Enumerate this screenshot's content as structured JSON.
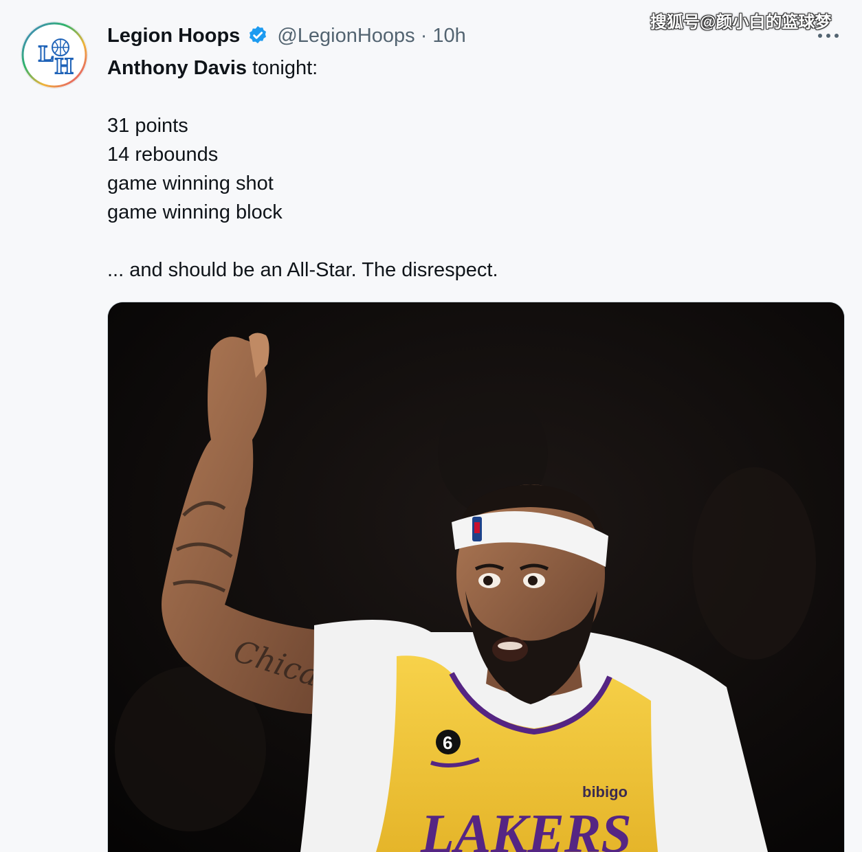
{
  "watermark": "搜狐号@颜小白的篮球梦",
  "tweet": {
    "author_name": "Legion Hoops",
    "author_handle": "@LegionHoops",
    "separator": "·",
    "time": "10h",
    "intro_bold": "Anthony Davis",
    "intro_rest": " tonight:",
    "stats": [
      "31 points",
      "14 rebounds",
      "game winning shot",
      "game winning block"
    ],
    "closing": "... and should be an All-Star. The disrespect."
  },
  "media": {
    "alt_jersey_number": "6",
    "jersey_text": "LAKERS",
    "patch_text": "bibigo",
    "tattoo_text": "Chicago"
  },
  "icons": {
    "avatar": "legion-hoops-logo",
    "verified": "verified-badge-icon",
    "more": "more-options-icon"
  },
  "colors": {
    "verified_blue": "#1d9bf0",
    "lakers_gold": "#f4c531",
    "lakers_purple": "#552583"
  }
}
